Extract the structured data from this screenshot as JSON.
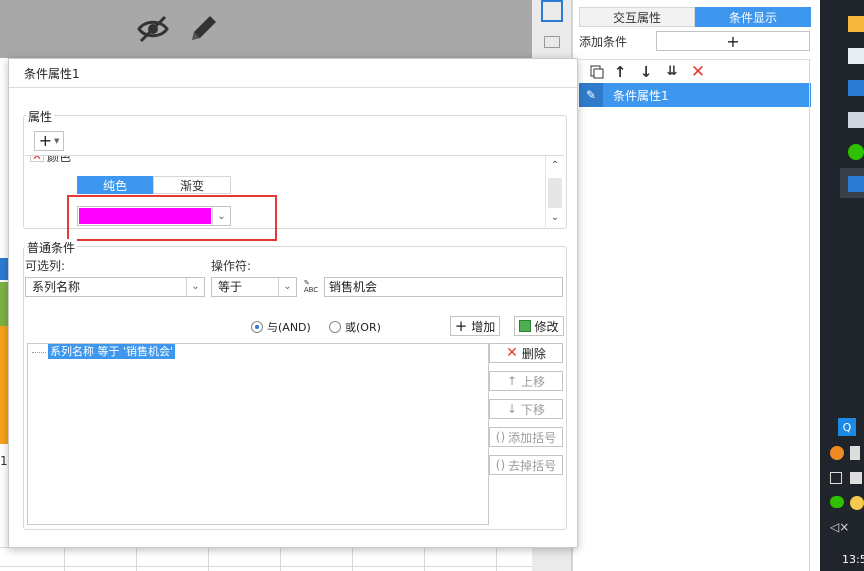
{
  "dialog": {
    "title": "条件属性1",
    "properties_legend": "属性",
    "add_label": "+",
    "attr_name_partial": "颜色",
    "color_tabs": [
      "纯色",
      "渐变"
    ],
    "color_value": "#ff00ff",
    "normal_cond_legend": "普通条件",
    "column_label": "可选列:",
    "operator_label": "操作符:",
    "column_value": "系列名称",
    "operator_value": "等于",
    "condition_value": "销售机会",
    "radio_and": "与(AND)",
    "radio_or": "或(OR)",
    "add_button": "增加",
    "modify_button": "修改",
    "condition_item": "系列名称 等于 '销售机会'",
    "delete_button": "删除",
    "up_button": "上移",
    "down_button": "下移",
    "add_bracket_button": "添加括号",
    "remove_bracket_button": "去掉括号"
  },
  "right_panel": {
    "tab_interaction": "交互属性",
    "tab_condition": "条件显示",
    "add_condition_label": "添加条件",
    "add_condition_btn": "+",
    "list_item": "条件属性1"
  },
  "taskbar": {
    "time_partial": "13:5"
  },
  "background": {
    "row_label": "1"
  }
}
